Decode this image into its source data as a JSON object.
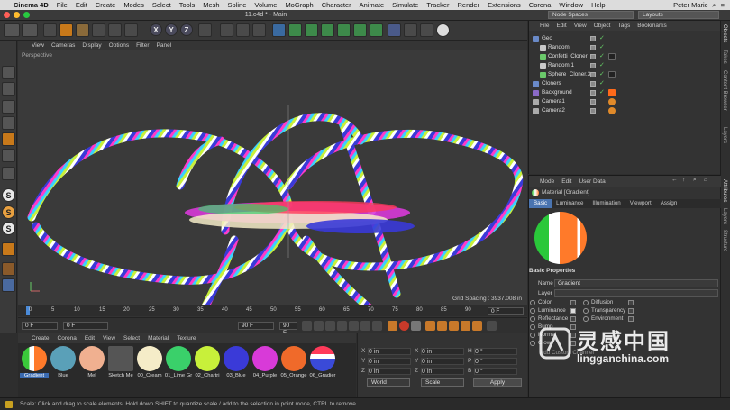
{
  "menubar": {
    "app": "Cinema 4D",
    "items": [
      "File",
      "Edit",
      "Create",
      "Modes",
      "Select",
      "Tools",
      "Mesh",
      "Spline",
      "Volume",
      "MoGraph",
      "Character",
      "Animate",
      "Simulate",
      "Tracker",
      "Render",
      "Extensions",
      "Corona",
      "Window",
      "Help"
    ],
    "user": "Peter Maric"
  },
  "title": "11.c4d * - Main",
  "layout": {
    "node_spaces": "Node Spaces",
    "layouts": "Layouts"
  },
  "toolbar": {
    "x": "X",
    "y": "Y",
    "z": "Z"
  },
  "viewport": {
    "menu": [
      "View",
      "Cameras",
      "Display",
      "Options",
      "Filter",
      "Panel"
    ],
    "label": "Perspective",
    "grid_spacing": "Grid Spacing : 3937.008 in"
  },
  "timeline": {
    "ticks": [
      "0",
      "5",
      "10",
      "15",
      "20",
      "25",
      "30",
      "35",
      "40",
      "45",
      "50",
      "55",
      "60",
      "65",
      "70",
      "75",
      "80",
      "85",
      "90"
    ],
    "current": "0 F",
    "start": "0 F",
    "end": "90 F",
    "max": "90 F",
    "frame_field": "0 F"
  },
  "materials": {
    "menu": [
      "Create",
      "Corona",
      "Edit",
      "View",
      "Select",
      "Material",
      "Texture"
    ],
    "items": [
      {
        "name": "Gradient",
        "color": "#ff7a2a",
        "selected": true
      },
      {
        "name": "Blue",
        "color": "#5aa0b8"
      },
      {
        "name": "Mel",
        "color": "#f0b090"
      },
      {
        "name": "Sketch Me",
        "color": "#555555"
      },
      {
        "name": "00_Cream",
        "color": "#f5ecc8"
      },
      {
        "name": "01_Lime Gr",
        "color": "#3ad06a"
      },
      {
        "name": "02_Chartri",
        "color": "#c8f03a"
      },
      {
        "name": "03_Blue",
        "color": "#3a3ad8"
      },
      {
        "name": "04_Purple",
        "color": "#d83ad8"
      },
      {
        "name": "05_Orange",
        "color": "#f06a2a"
      },
      {
        "name": "06_Gradier",
        "color": "#3a4ad8"
      }
    ]
  },
  "coords": {
    "pos": [
      "X",
      "Y",
      "Z"
    ],
    "rot": [
      "X",
      "Y",
      "Z"
    ],
    "size": [
      "H",
      "P",
      "B"
    ],
    "values": [
      "0 in",
      "0 in",
      "0 in",
      "0 in",
      "0 in",
      "0 in",
      "0 °",
      "0 °",
      "0 °"
    ],
    "world": "World",
    "scale": "Scale",
    "apply": "Apply"
  },
  "status": "Scale: Click and drag to scale elements. Hold down SHIFT to quantize scale / add to the selection in point mode, CTRL to remove.",
  "objects": {
    "menu": [
      "File",
      "Edit",
      "View",
      "Object",
      "Tags",
      "Bookmarks"
    ],
    "rows": [
      {
        "name": "Geo",
        "indent": 0,
        "icon": "#6a8ac8"
      },
      {
        "name": "Random",
        "indent": 1,
        "icon": "#c8c8c8"
      },
      {
        "name": "Confetti_Cloner",
        "indent": 1,
        "icon": "#6ac86a"
      },
      {
        "name": "Random.1",
        "indent": 1,
        "icon": "#c8c8c8"
      },
      {
        "name": "Sphere_Cloner.3",
        "indent": 1,
        "icon": "#6ac86a"
      },
      {
        "name": "Cloners",
        "indent": 0,
        "icon": "#6a8ac8"
      },
      {
        "name": "Background",
        "indent": 0,
        "icon": "#8a6ac8"
      },
      {
        "name": "Camera1",
        "indent": 0,
        "icon": "#aaaaaa"
      },
      {
        "name": "Camera2",
        "indent": 0,
        "icon": "#aaaaaa"
      }
    ]
  },
  "side_tabs_top": [
    "Objects",
    "Takes",
    "Content Browser",
    "Layers"
  ],
  "side_tabs_bottom": [
    "Attributes",
    "Layers",
    "Structure"
  ],
  "attributes": {
    "menu": [
      "Mode",
      "Edit",
      "User Data"
    ],
    "title": "Material [Gradient]",
    "tabs": [
      "Basic",
      "Luminance",
      "Illumination",
      "Viewport",
      "Assign"
    ],
    "section": "Basic Properties",
    "name_label": "Name",
    "name_value": "Gradient",
    "layer_label": "Layer",
    "left_channels": [
      {
        "label": "Color",
        "on": false
      },
      {
        "label": "Luminance",
        "on": true
      },
      {
        "label": "Reflectance",
        "on": false
      },
      {
        "label": "Bump",
        "on": false
      },
      {
        "label": "Normal",
        "on": false
      },
      {
        "label": "Glow",
        "on": false
      },
      {
        "label": "Add Custom Channel",
        "on": false
      }
    ],
    "right_channels": [
      {
        "label": "Diffusion",
        "on": false
      },
      {
        "label": "Transparency",
        "on": false
      },
      {
        "label": "Environment",
        "on": false
      }
    ]
  },
  "watermark": {
    "cn": "灵感中国",
    "url": "lingganchina.com"
  }
}
